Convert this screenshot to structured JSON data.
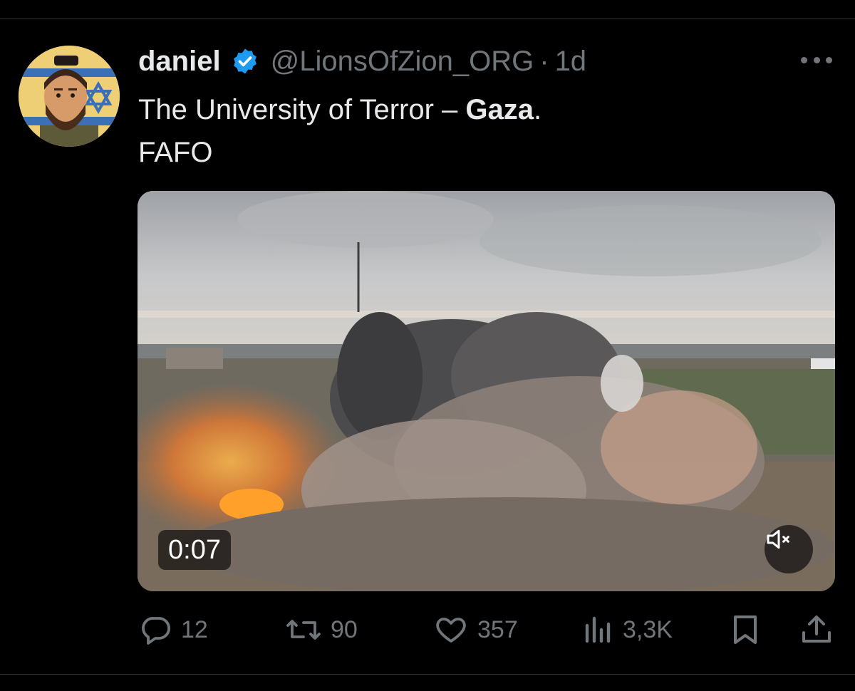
{
  "tweet": {
    "display_name": "daniel",
    "handle": "@LionsOfZion_ORG",
    "separator": "·",
    "time": "1d",
    "text_line1_prefix": "The University of Terror – ",
    "text_line1_bold": "Gaza",
    "text_line1_suffix": ".",
    "text_line2": "FAFO"
  },
  "media": {
    "duration": "0:07"
  },
  "actions": {
    "replies": "12",
    "reposts": "90",
    "likes": "357",
    "views": "3,3K"
  },
  "icons": [
    "verified-badge-icon",
    "more-icon",
    "mute-icon",
    "reply-icon",
    "repost-icon",
    "like-icon",
    "views-icon",
    "bookmark-icon",
    "share-icon"
  ],
  "colors": {
    "background": "#000000",
    "text": "#e7e9ea",
    "secondary": "#71767b",
    "verified": "#1d9bf0"
  }
}
